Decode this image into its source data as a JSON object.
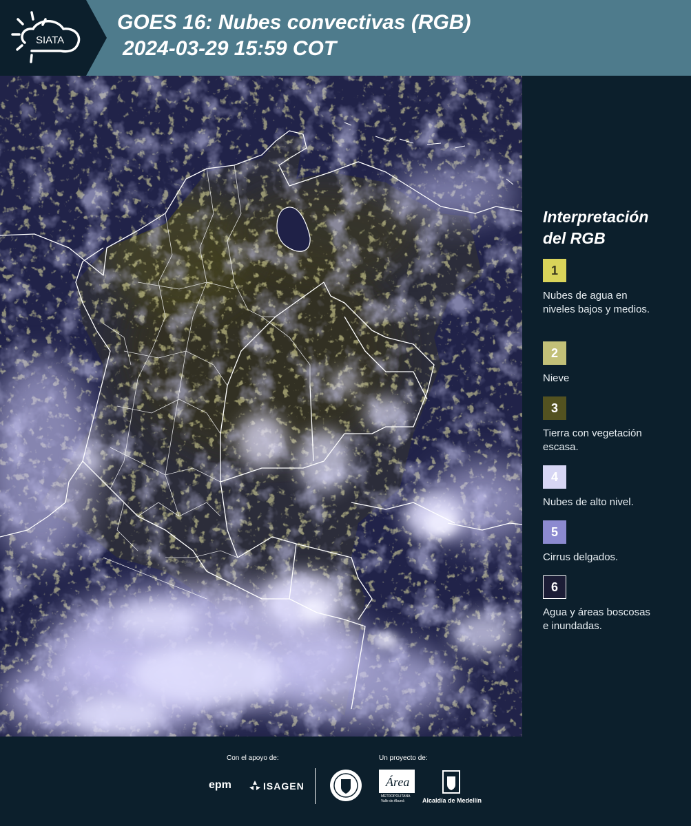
{
  "header": {
    "logo_text": "SIATA",
    "title_line1": "GOES 16: Nubes convectivas (RGB)",
    "title_line2": "2024-03-29 15:59 COT"
  },
  "legend": {
    "title_line1": "Interpretación",
    "title_line2": "del RGB",
    "items": [
      {
        "number": "1",
        "color": "#d9d45a",
        "text_color": "#3b3a1f",
        "label_line1": "Nubes de agua en",
        "label_line2": "niveles bajos y medios."
      },
      {
        "number": "2",
        "color": "#c2c078",
        "text_color": "#ffffff",
        "label_line1": "Nieve",
        "label_line2": ""
      },
      {
        "number": "3",
        "color": "#535220",
        "text_color": "#ffffff",
        "label_line1": "Tierra con vegetación",
        "label_line2": "escasa."
      },
      {
        "number": "4",
        "color": "#d7d6f4",
        "text_color": "#ffffff",
        "label_line1": "Nubes de alto nivel.",
        "label_line2": ""
      },
      {
        "number": "5",
        "color": "#8c8ad0",
        "text_color": "#ffffff",
        "label_line1": "Cirrus delgados.",
        "label_line2": ""
      },
      {
        "number": "6",
        "color": "#1c1d36",
        "text_color": "#ffffff",
        "label_line1": "Agua y áreas boscosas",
        "label_line2": "e inundadas."
      }
    ]
  },
  "footer": {
    "support_label": "Con el apoyo de:",
    "project_label": "Un proyecto de:",
    "sponsor_epm": "epm",
    "sponsor_isagen": "ISAGEN",
    "area_name": "Área",
    "area_sub_line1": "METROPOLITANA",
    "area_sub_line2": "Valle de Aburrá",
    "alcaldia": "Alcaldía de Medellín"
  }
}
